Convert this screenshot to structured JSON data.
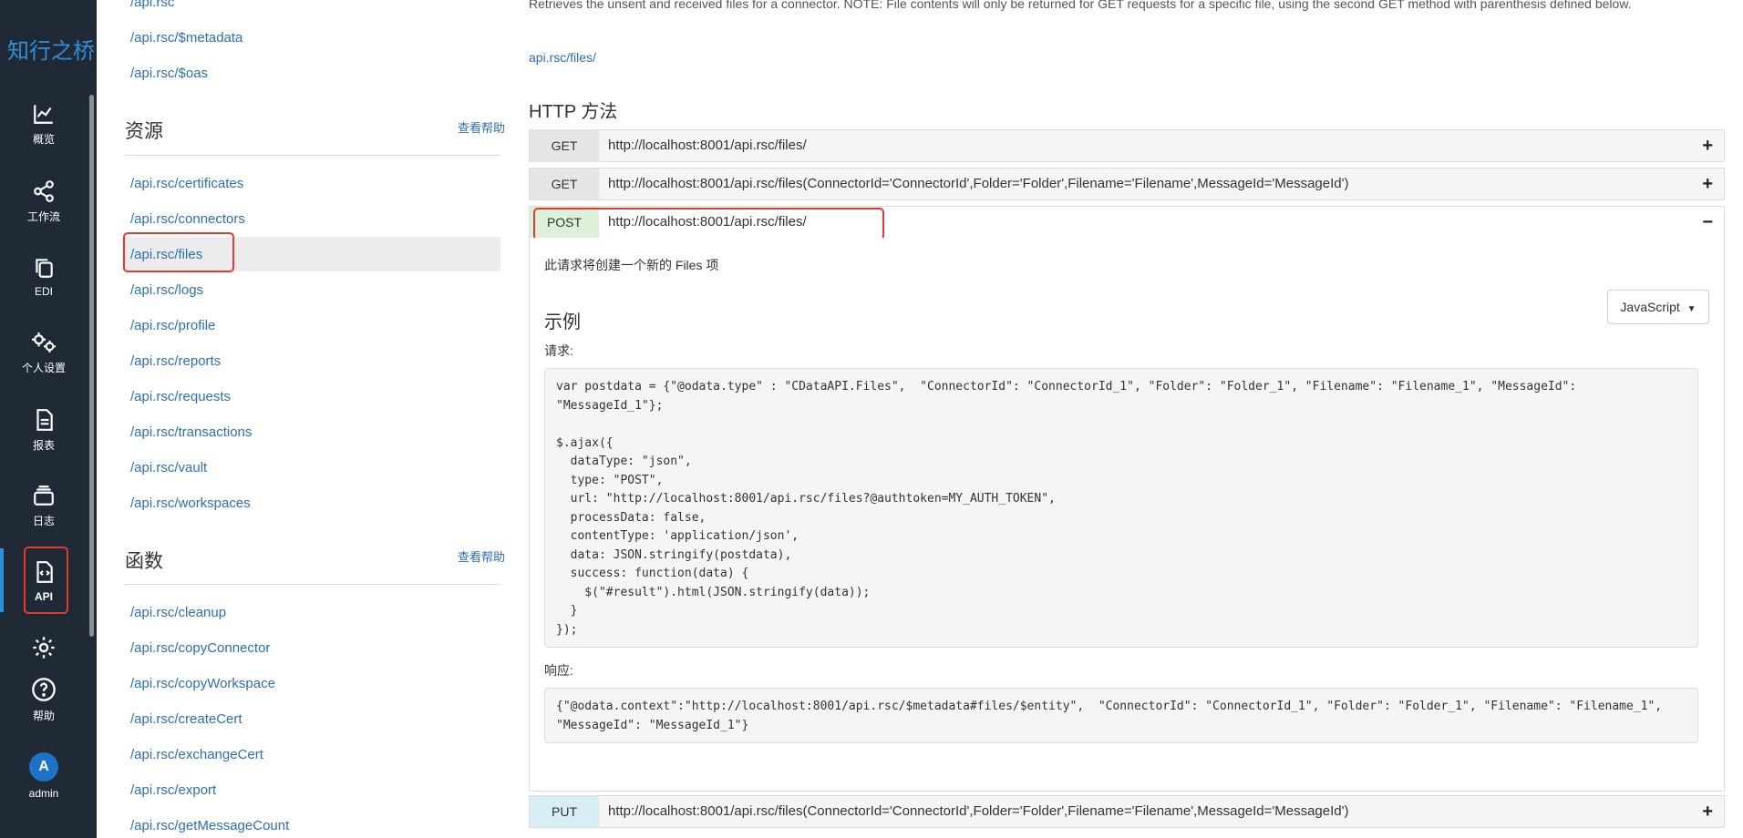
{
  "app": {
    "logo": "知行之桥"
  },
  "rail": [
    {
      "name": "overview",
      "label": "概览"
    },
    {
      "name": "workflow",
      "label": "工作流"
    },
    {
      "name": "edi",
      "label": "EDI"
    },
    {
      "name": "personal-settings",
      "label": "个人设置"
    },
    {
      "name": "reports",
      "label": "报表"
    },
    {
      "name": "logs",
      "label": "日志"
    },
    {
      "name": "api",
      "label": "API",
      "active": true
    },
    {
      "name": "settings",
      "label": ""
    },
    {
      "name": "help",
      "label": "帮助"
    }
  ],
  "user": {
    "avatar_letter": "A",
    "name": "admin"
  },
  "list": {
    "top_links": [
      "/api.rsc",
      "/api.rsc/$metadata",
      "/api.rsc/$oas"
    ],
    "resources_title": "资源",
    "resources_help": "查看帮助",
    "resources": [
      "/api.rsc/certificates",
      "/api.rsc/connectors",
      "/api.rsc/files",
      "/api.rsc/logs",
      "/api.rsc/profile",
      "/api.rsc/reports",
      "/api.rsc/requests",
      "/api.rsc/transactions",
      "/api.rsc/vault",
      "/api.rsc/workspaces"
    ],
    "functions_title": "函数",
    "functions_help": "查看帮助",
    "functions": [
      "/api.rsc/cleanup",
      "/api.rsc/copyConnector",
      "/api.rsc/copyWorkspace",
      "/api.rsc/createCert",
      "/api.rsc/exchangeCert",
      "/api.rsc/export",
      "/api.rsc/getMessageCount"
    ]
  },
  "main": {
    "description": "Retrieves the unsent and received files for a connector. NOTE: File contents will only be returned for GET requests for a specific file, using the second GET method with parenthesis defined below.",
    "resource_link": "api.rsc/files/",
    "http_title": "HTTP 方法",
    "methods": [
      {
        "verb": "GET",
        "url": "http://localhost:8001/api.rsc/files/",
        "toggle": "+"
      },
      {
        "verb": "GET",
        "url": "http://localhost:8001/api.rsc/files(ConnectorId='ConnectorId',Folder='Folder',Filename='Filename',MessageId='MessageId')",
        "toggle": "+"
      },
      {
        "verb": "POST",
        "url": "http://localhost:8001/api.rsc/files/",
        "toggle": "−"
      },
      {
        "verb": "PUT",
        "url": "http://localhost:8001/api.rsc/files(ConnectorId='ConnectorId',Folder='Folder',Filename='Filename',MessageId='MessageId')",
        "toggle": "+"
      }
    ],
    "post_panel": {
      "summary": "此请求将创建一个新的 Files 项",
      "example_title": "示例",
      "language": "JavaScript",
      "request_label": "请求:",
      "request_code": "var postdata = {\"@odata.type\" : \"CDataAPI.Files\",  \"ConnectorId\": \"ConnectorId_1\", \"Folder\": \"Folder_1\", \"Filename\": \"Filename_1\", \"MessageId\":\n\"MessageId_1\"};\n\n$.ajax({\n  dataType: \"json\",\n  type: \"POST\",\n  url: \"http://localhost:8001/api.rsc/files?@authtoken=MY_AUTH_TOKEN\",\n  processData: false,\n  contentType: 'application/json',\n  data: JSON.stringify(postdata),\n  success: function(data) {\n    $(\"#result\").html(JSON.stringify(data));\n  }\n});",
      "response_label": "响应:",
      "response_code": "{\"@odata.context\":\"http://localhost:8001/api.rsc/$metadata#files/$entity\",  \"ConnectorId\": \"ConnectorId_1\", \"Folder\": \"Folder_1\", \"Filename\": \"Filename_1\",\n\"MessageId\": \"MessageId_1\"}"
    }
  }
}
